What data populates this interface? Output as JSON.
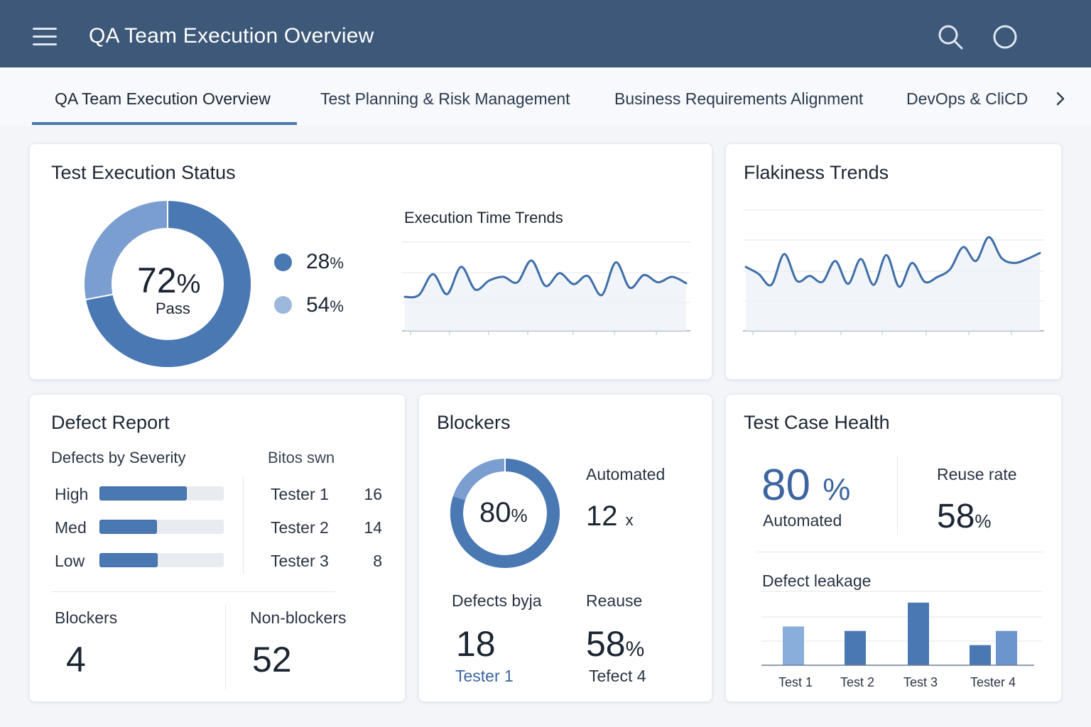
{
  "header": {
    "title": "QA Team Execution Overview",
    "icons": [
      "menu-icon",
      "search-icon",
      "user-circle-icon"
    ]
  },
  "tabs": [
    {
      "label": "QA Team Execution Overview",
      "active": true
    },
    {
      "label": "Test Planning & Risk Management",
      "active": false
    },
    {
      "label": "Business Requirements Alignment",
      "active": false
    },
    {
      "label": "DevOps & CliCD",
      "active": false
    }
  ],
  "execution_status": {
    "title": "Test Execution Status",
    "pass_value": "72",
    "pass_unit": "%",
    "pass_label": "Pass",
    "pass_fraction": 0.72,
    "legend": [
      {
        "value": "28",
        "unit": "%",
        "color": "#4a78b3"
      },
      {
        "value": "54",
        "unit": "%",
        "color": "#9db8dc"
      }
    ],
    "trend_title": "Execution Time Trends"
  },
  "flakiness": {
    "title": "Flakiness Trends"
  },
  "defect_report": {
    "title": "Defect Report",
    "severity_title": "Defects by Severity",
    "severity": [
      {
        "label": "High",
        "level": 0.7
      },
      {
        "label": "Med",
        "level": 0.46
      },
      {
        "label": "Low",
        "level": 0.47
      }
    ],
    "testers_title": "Bitos  swn",
    "testers": [
      {
        "name": "Tester 1",
        "count": "16"
      },
      {
        "name": "Tester 2",
        "count": "14"
      },
      {
        "name": "Tester 3",
        "count": "8"
      }
    ],
    "blockers_label": "Blockers",
    "blockers_value": "4",
    "nonblockers_label": "Non-blockers",
    "nonblockers_value": "52"
  },
  "blockers": {
    "title": "Blockers",
    "ring_value": "80",
    "ring_unit": "%",
    "ring_fraction": 0.8,
    "automated_label": "Automated",
    "automated_value": "12",
    "automated_unit": "x",
    "defects_label": "Defects byja",
    "defects_value": "18",
    "defects_sub": "Tester 1",
    "reause_label": "Reause",
    "reause_value": "58",
    "reause_unit": "%",
    "reause_sub": "Tefect 4"
  },
  "test_case_health": {
    "title": "Test Case Health",
    "automated_value": "80",
    "automated_unit": "%",
    "automated_label": "Automated",
    "reuse_label": "Reuse rate",
    "reuse_value": "58",
    "reuse_unit": "%",
    "leakage_title": "Defect leakage"
  },
  "colors": {
    "header": "#3d5878",
    "accent": "#4a78b3",
    "accent_light": "#9db8dc",
    "line": "#3f6fa8"
  },
  "chart_data": [
    {
      "type": "pie",
      "title": "72% Pass",
      "values": [
        72,
        28
      ],
      "colors": [
        "#4a78b3",
        "#7a9ecf"
      ]
    },
    {
      "type": "line",
      "title": "Execution Time Trends",
      "x": [
        0,
        1,
        2,
        3,
        4,
        5,
        6,
        7,
        8,
        9,
        10,
        11,
        12,
        13,
        14,
        15,
        16,
        17,
        18,
        19,
        20
      ],
      "y": [
        1.0,
        1.2,
        3.5,
        1.3,
        4.3,
        1.8,
        2.8,
        3.2,
        2.6,
        5.0,
        2.2,
        3.6,
        2.4,
        3.3,
        1.2,
        4.8,
        2.0,
        3.4,
        2.6,
        3.2,
        2.5
      ],
      "ylim": [
        0,
        6
      ],
      "grid": true
    },
    {
      "type": "line",
      "title": "Flakiness Trends",
      "x": [
        0,
        1,
        2,
        3,
        4,
        5,
        6,
        7,
        8,
        9,
        10,
        11,
        12,
        13,
        14,
        15,
        16,
        17,
        18,
        19,
        20,
        21,
        22,
        23
      ],
      "y": [
        3.0,
        2.3,
        1.2,
        4.3,
        1.6,
        2.1,
        1.5,
        3.6,
        1.3,
        3.8,
        1.2,
        4.2,
        1.0,
        3.4,
        1.5,
        2.0,
        2.8,
        5.0,
        3.6,
        6.0,
        3.9,
        3.4,
        3.8,
        4.4
      ],
      "ylim": [
        0,
        7
      ],
      "grid": true
    },
    {
      "type": "pie",
      "title": "80%",
      "values": [
        80,
        20
      ],
      "colors": [
        "#4a78b3",
        "#7a9ecf"
      ]
    },
    {
      "type": "bar",
      "title": "Defect leakage",
      "categories": [
        "Test 1",
        "Test 2",
        "Test 3",
        "Tester 4",
        ""
      ],
      "values": [
        52,
        46,
        84,
        27,
        46
      ],
      "ylim": [
        0,
        100
      ],
      "grid": true,
      "colors": [
        "#8aaedc",
        "#4a78b3",
        "#4a78b3",
        "#4a78b3",
        "#6b95cc"
      ]
    }
  ]
}
